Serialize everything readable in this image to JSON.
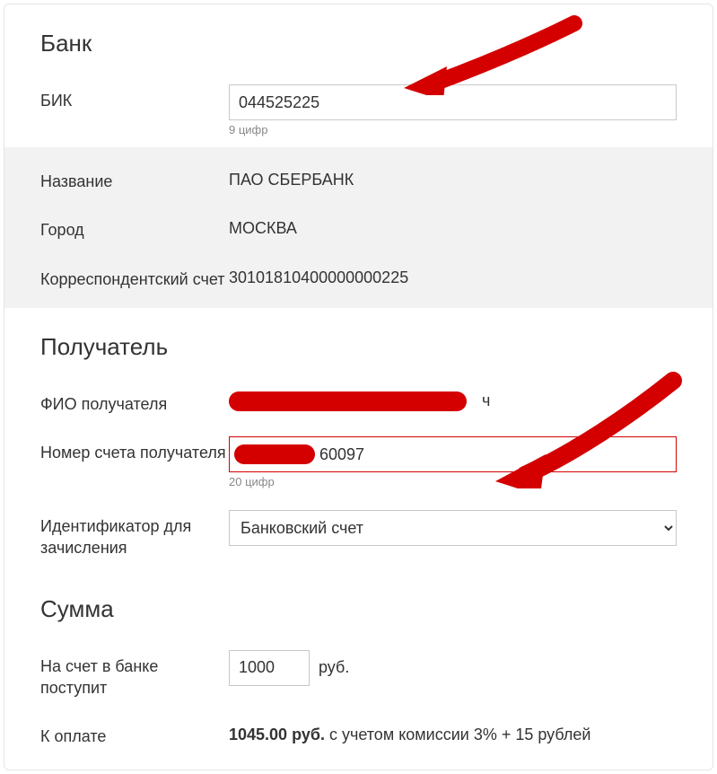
{
  "bank": {
    "section_title": "Банк",
    "bik_label": "БИК",
    "bik_value": "044525225",
    "bik_hint": "9 цифр",
    "name_label": "Название",
    "name_value": "ПАО СБЕРБАНК",
    "city_label": "Город",
    "city_value": "МОСКВА",
    "corr_label": "Корреспондентский счет",
    "corr_value": "30101810400000000225"
  },
  "recipient": {
    "section_title": "Получатель",
    "fio_label": "ФИО получателя",
    "fio_visible_suffix": "ч",
    "account_label": "Номер счета получателя",
    "account_visible_suffix": "60097",
    "account_hint": "20 цифр",
    "ident_label": "Идентификатор для зачисления",
    "ident_value": "Банковский счет"
  },
  "amount": {
    "section_title": "Сумма",
    "credit_label": "На счет в банке поступит",
    "credit_value": "1000",
    "unit": "руб.",
    "total_label": "К оплате",
    "total_value": "1045.00 руб.",
    "total_suffix": " с учетом комиссии 3% + 15 рублей"
  }
}
